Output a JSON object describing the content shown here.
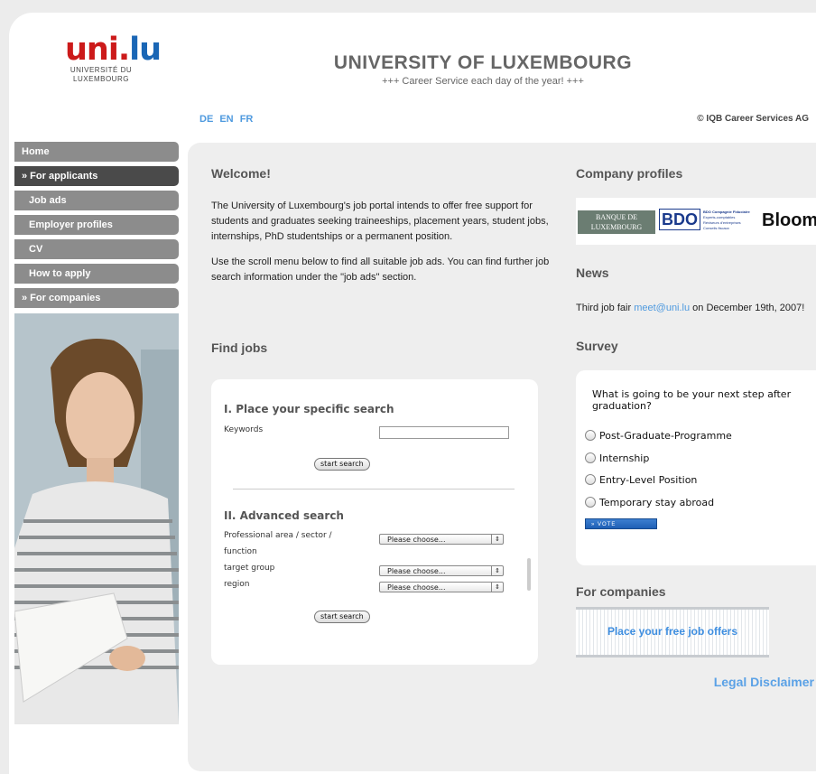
{
  "header": {
    "logo_mark_red": "uni.",
    "logo_mark_blue": "lu",
    "logo_line1": "UNIVERSITÉ DU",
    "logo_line2": "LUXEMBOURG",
    "title": "UNIVERSITY OF LUXEMBOURG",
    "subtitle": "+++ Career Service each day of the year! +++",
    "languages": [
      "DE",
      "EN",
      "FR"
    ],
    "copyright": "© IQB Career Services AG"
  },
  "sidebar": {
    "items": [
      {
        "label": "Home"
      },
      {
        "label": "» For applicants"
      },
      {
        "label": "Job ads"
      },
      {
        "label": "Employer profiles"
      },
      {
        "label": "CV"
      },
      {
        "label": "How to apply"
      },
      {
        "label": "» For companies"
      }
    ]
  },
  "welcome": {
    "heading": "Welcome!",
    "para1": "The University of Luxembourg's job portal intends to offer free support for students and graduates seeking traineeships, placement years, student jobs, internships, PhD studentships or a permanent position.",
    "para2": "Use the scroll menu below to find all suitable job ads. You can find further job search information under the \"job ads\" section."
  },
  "find_jobs": {
    "heading": "Find jobs",
    "specific_heading": "I. Place your specific search",
    "keywords_label": "Keywords",
    "keywords_value": "",
    "start_search_label": "start search",
    "advanced_heading": "II. Advanced search",
    "field1_label": "Professional area / sector / function",
    "field2_label": "target group",
    "field3_label": "region",
    "select_placeholder": "Please choose...",
    "start_search_label2": "start search"
  },
  "company_profiles": {
    "heading": "Company profiles",
    "logos": [
      "BANQUE DE LUXEMBOURG",
      "BDO",
      "BDO Compagnie Fiduciaire",
      "Bloom"
    ],
    "bdo_desc_lines": [
      "Experts-comptables",
      "Réviseurs d'entreprises",
      "Conseils fiscaux"
    ]
  },
  "news": {
    "heading": "News",
    "text_before": "Third job fair ",
    "link": "meet@uni.lu",
    "text_after": " on December 19th, 2007!"
  },
  "survey": {
    "heading": "Survey",
    "question": "What is going to be your next step after graduation?",
    "options": [
      "Post-Graduate-Programme",
      "Internship",
      "Entry-Level Position",
      "Temporary stay abroad"
    ],
    "vote_label": "» VOTE"
  },
  "for_companies": {
    "heading": "For companies",
    "banner": "Place your free job offers"
  },
  "footer": {
    "legal": "Legal Disclaimer"
  },
  "colors": {
    "brand_red": "#cc1a1a",
    "brand_blue": "#1a66b5",
    "link_blue": "#4f9adf",
    "nav_gray": "#8c8c8c",
    "nav_active": "#4a4a4a"
  }
}
